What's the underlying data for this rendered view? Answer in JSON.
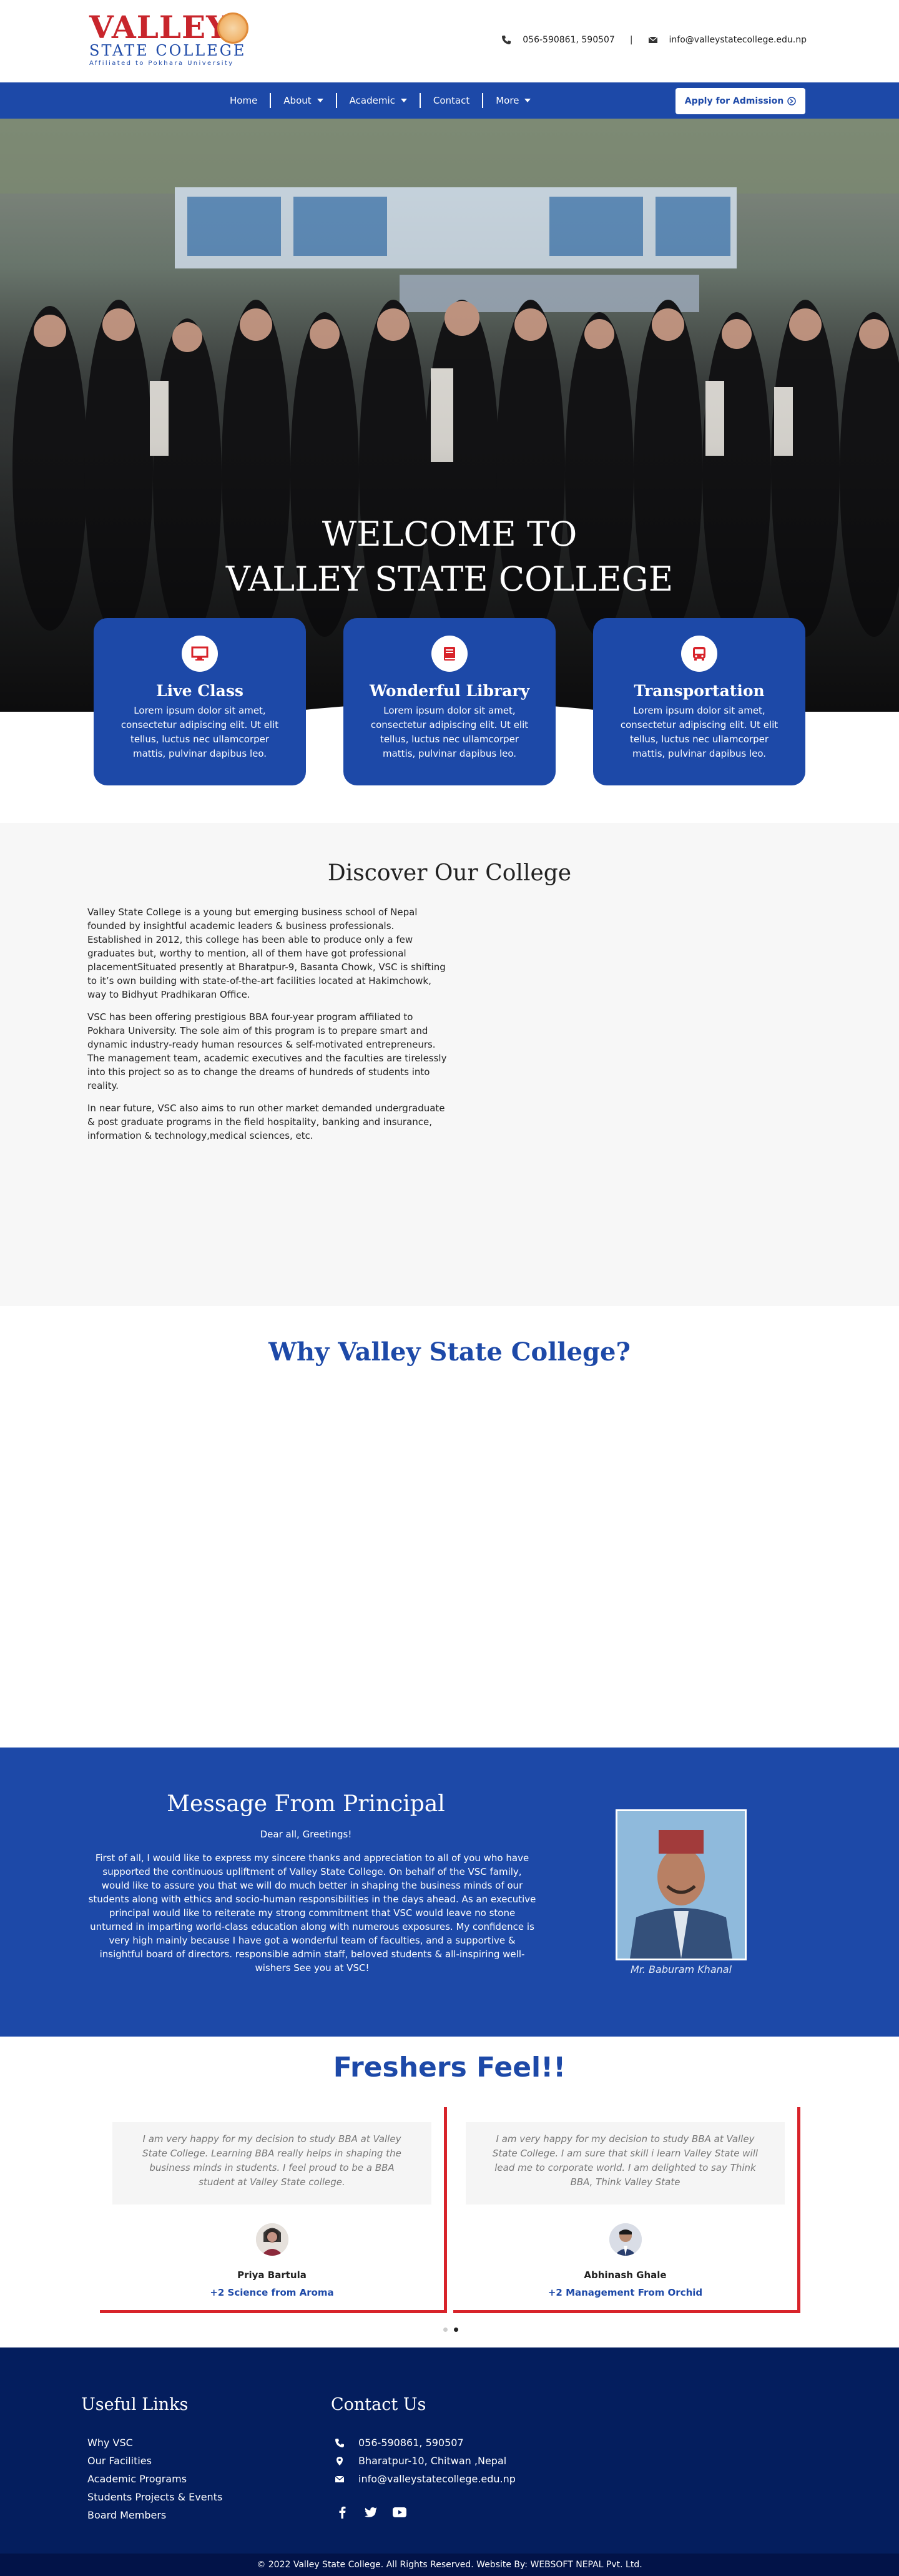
{
  "header": {
    "logo": {
      "line1": "VALLEY",
      "line2": "STATE COLLEGE",
      "line3": "Affiliated to Pokhara University"
    },
    "phone": "056-590861, 590507",
    "separator": "|",
    "email": "info@valleystatecollege.edu.np"
  },
  "nav": {
    "items": [
      {
        "label": "Home"
      },
      {
        "label": "About"
      },
      {
        "label": "Academic"
      },
      {
        "label": "Contact"
      },
      {
        "label": "More"
      }
    ],
    "apply": "Apply for Admission"
  },
  "hero": {
    "title_line1": "WELCOME TO",
    "title_line2": "VALLEY STATE COLLEGE",
    "cards": [
      {
        "icon": "monitor-icon",
        "title": "Live Class",
        "text": "Lorem ipsum dolor sit amet, consectetur adipiscing elit. Ut elit tellus, luctus nec ullamcorper mattis, pulvinar dapibus leo."
      },
      {
        "icon": "book-icon",
        "title": "Wonderful Library",
        "text": "Lorem ipsum dolor sit amet, consectetur adipiscing elit. Ut elit tellus, luctus nec ullamcorper mattis, pulvinar dapibus leo."
      },
      {
        "icon": "bus-icon",
        "title": "Transportation",
        "text": "Lorem ipsum dolor sit amet, consectetur adipiscing elit. Ut elit tellus, luctus nec ullamcorper mattis, pulvinar dapibus leo."
      }
    ]
  },
  "discover": {
    "title": "Discover Our College",
    "p1": "Valley State College is a young but emerging business school of Nepal founded by insightful academic leaders & business professionals. Established in 2012, this college has been able to produce only a few graduates but, worthy to mention, all of them have got professional placementSituated presently at Bharatpur-9, Basanta Chowk, VSC is shifting to it’s own building with state-of-the-art facilities located at Hakimchowk, way to Bidhyut Pradhikaran Office.",
    "p2": "VSC has been offering prestigious BBA four-year program affiliated to Pokhara University. The sole aim of this program is to prepare smart and dynamic industry-ready human resources & self-motivated entrepreneurs. The management team, academic executives and the faculties are tirelessly into this project so as to change the dreams of hundreds of students into reality.",
    "p3": " In near future, VSC also aims to run other market demanded undergraduate & post graduate programs in the field hospitality, banking and insurance, information & technology,medical sciences, etc."
  },
  "why": {
    "title": "Why Valley State College?"
  },
  "principal": {
    "title": "Message From Principal",
    "greeting": "Dear all, Greetings!",
    "message": "First of all, I would like to express my sincere thanks and appreciation to all of you who have supported the continuous upliftment of Valley State College. On behalf of the VSC family, would like to assure you that we will do much better in shaping the business minds of our students along with ethics and socio-human responsibilities in the days ahead. As an executive principal would like to reiterate my strong commitment that VSC would leave no stone unturned in imparting world-class education along with numerous exposures. My confidence is very high mainly because I have got a wonderful team of faculties, and a supportive & insightful board of directors. responsible admin staff, beloved students & all-inspiring well-wishers See you at VSC!",
    "name": "Mr. Baburam Khanal"
  },
  "freshers": {
    "title": "Freshers Feel!!",
    "items": [
      {
        "quote": "I am very happy for my decision to study BBA at Valley State College. Learning BBA really helps in shaping the business minds in students. I feel proud to be a BBA student at Valley State college.",
        "name": "Priya Bartula",
        "program": "+2 Science from Aroma"
      },
      {
        "quote": "I am very happy for my decision to study BBA at Valley State College. I am sure that skill i learn Valley State will lead me to corporate world. I am delighted to say Think BBA, Think Valley State",
        "name": "Abhinash Ghale",
        "program": "+2 Management From Orchid"
      }
    ]
  },
  "footer": {
    "useful_title": "Useful Links",
    "links": [
      "Why VSC",
      "Our Facilities",
      "Academic Programs",
      "Students Projects & Events",
      "Board Members"
    ],
    "contact_title": "Contact Us",
    "phone": "056-590861, 590507",
    "address": "Bharatpur-10, Chitwan ,Nepal",
    "email": "info@valleystatecollege.edu.np",
    "copyright": "© 2022 Valley State College. All Rights Reserved. Website By: WEBSOFT NEPAL Pvt. Ltd."
  },
  "colors": {
    "primary": "#1d49a8",
    "accent_red": "#d8232a",
    "footer": "#041e5e"
  }
}
